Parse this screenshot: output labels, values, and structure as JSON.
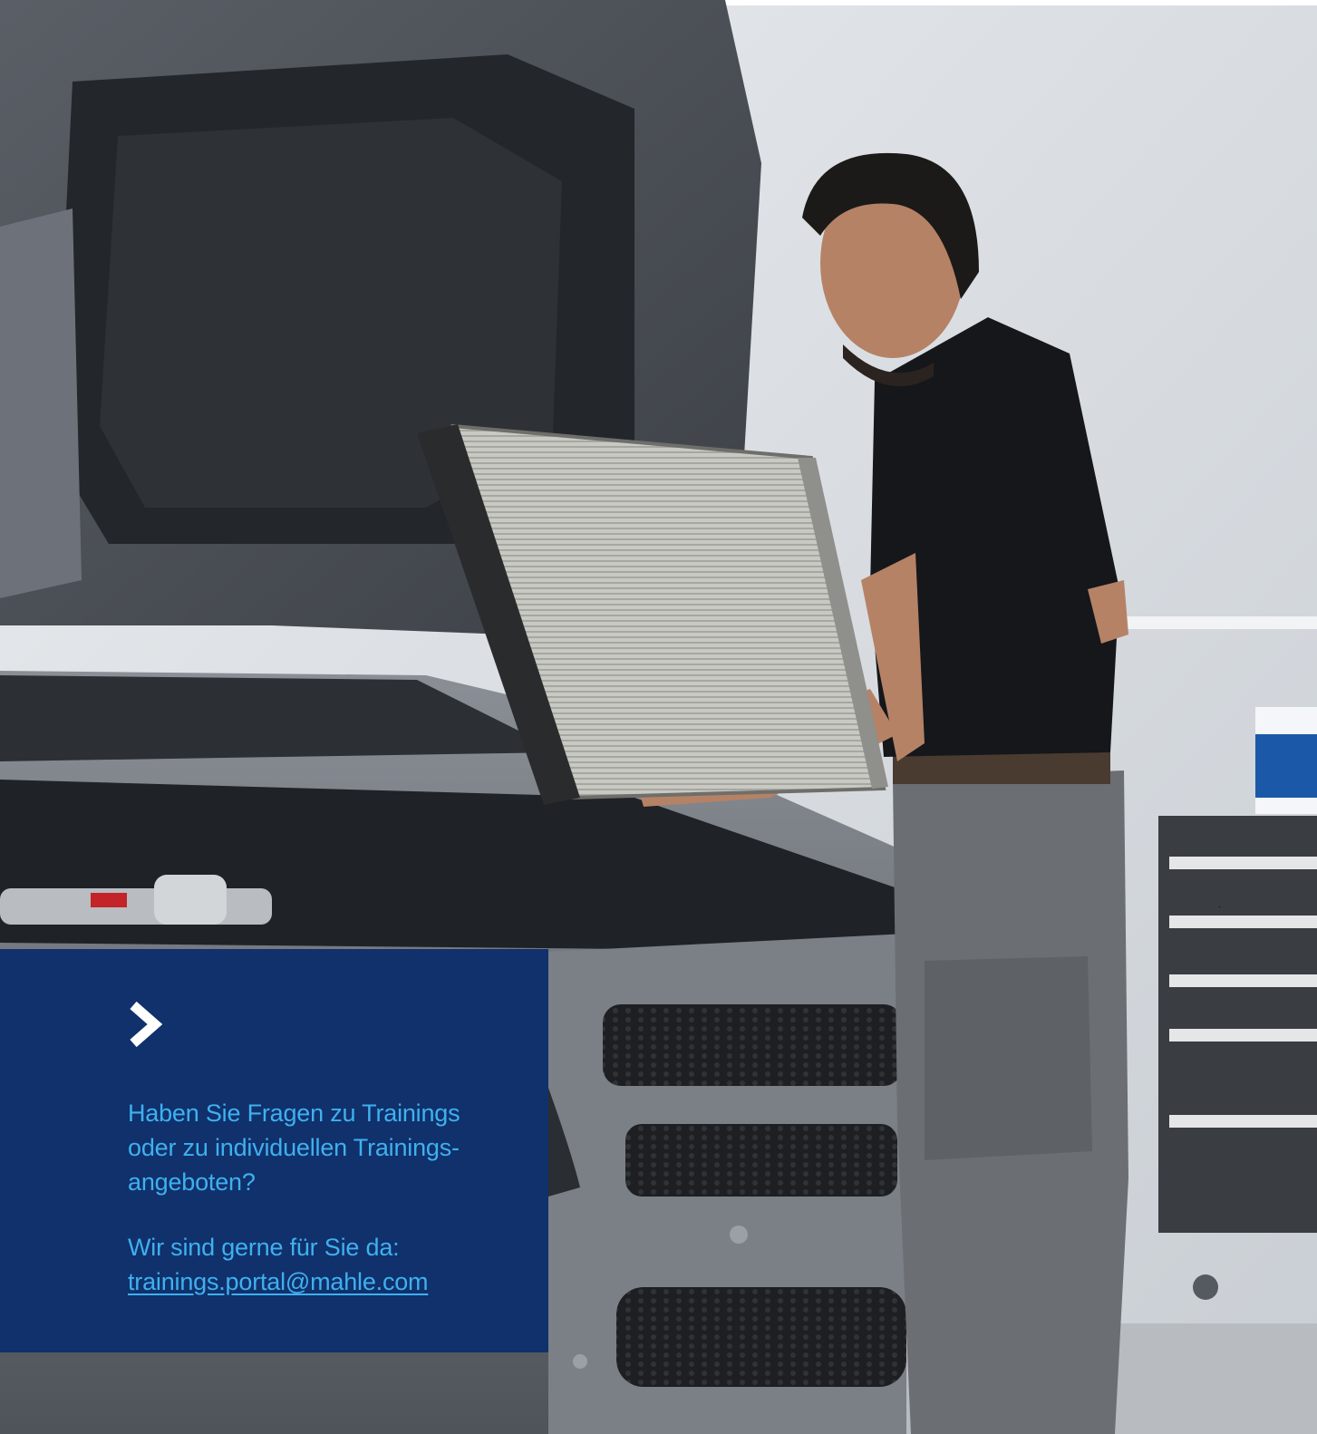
{
  "hero": {
    "icons": [
      "car-hood-icon",
      "radiator-icon",
      "mechanic-icon",
      "tool-cabinet-icon"
    ],
    "colors": {
      "wall": "#dfe3e8",
      "car": "#6a6f77",
      "shirt": "#15171a",
      "pants": "#6b6e73"
    }
  },
  "panel": {
    "background": "#10316b",
    "text_color": "#3fb0f0",
    "chevron_icon": "chevron-right-icon",
    "question_lines": [
      "Haben Sie Fragen zu Trainings",
      "oder zu individuellen Trainings-",
      "angeboten?"
    ],
    "contact_text": "Wir sind gerne für Sie da:",
    "email": "trainings.portal@mahle.com"
  }
}
